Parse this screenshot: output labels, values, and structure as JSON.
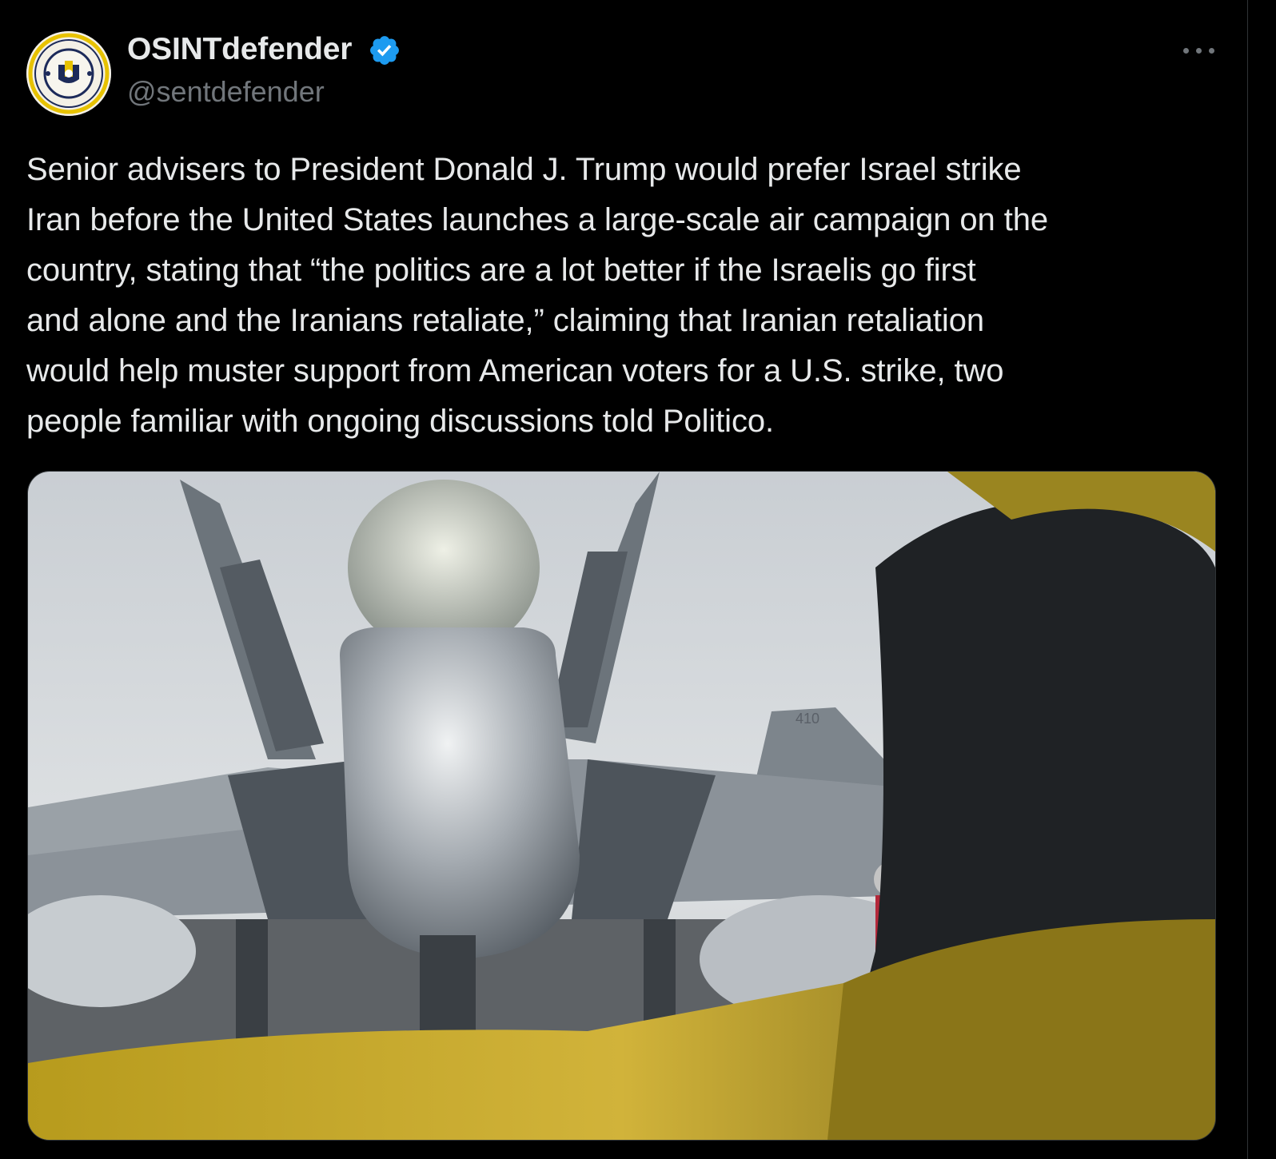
{
  "post": {
    "author": {
      "display_name": "OSINTdefender",
      "handle": "@sentdefender",
      "verified": true,
      "avatar": {
        "type": "logo",
        "seal_text_top": "OSINT DEFENDER",
        "seal_text_bottom": "INTELLIGENCE MONITOR"
      }
    },
    "more_icon": "more-horizontal-icon",
    "text": "Senior advisers to President Donald J. Trump would prefer Israel strike\nIran before the United States launches a large-scale air campaign on the\ncountry, stating that “the politics are a lot better if the Israelis go first\nand alone and the Iranians retaliate,” claiming that Iranian retaliation\nwould help muster support from American voters for a U.S. strike, two\npeople familiar with ongoing discussions told Politico.",
    "media": {
      "type": "photo",
      "tail_number": "410"
    }
  },
  "colors": {
    "background": "#000000",
    "text_primary": "#e7e9ea",
    "text_secondary": "#71767b",
    "verified_badge": "#1d9bf0",
    "border": "#2f3336"
  }
}
